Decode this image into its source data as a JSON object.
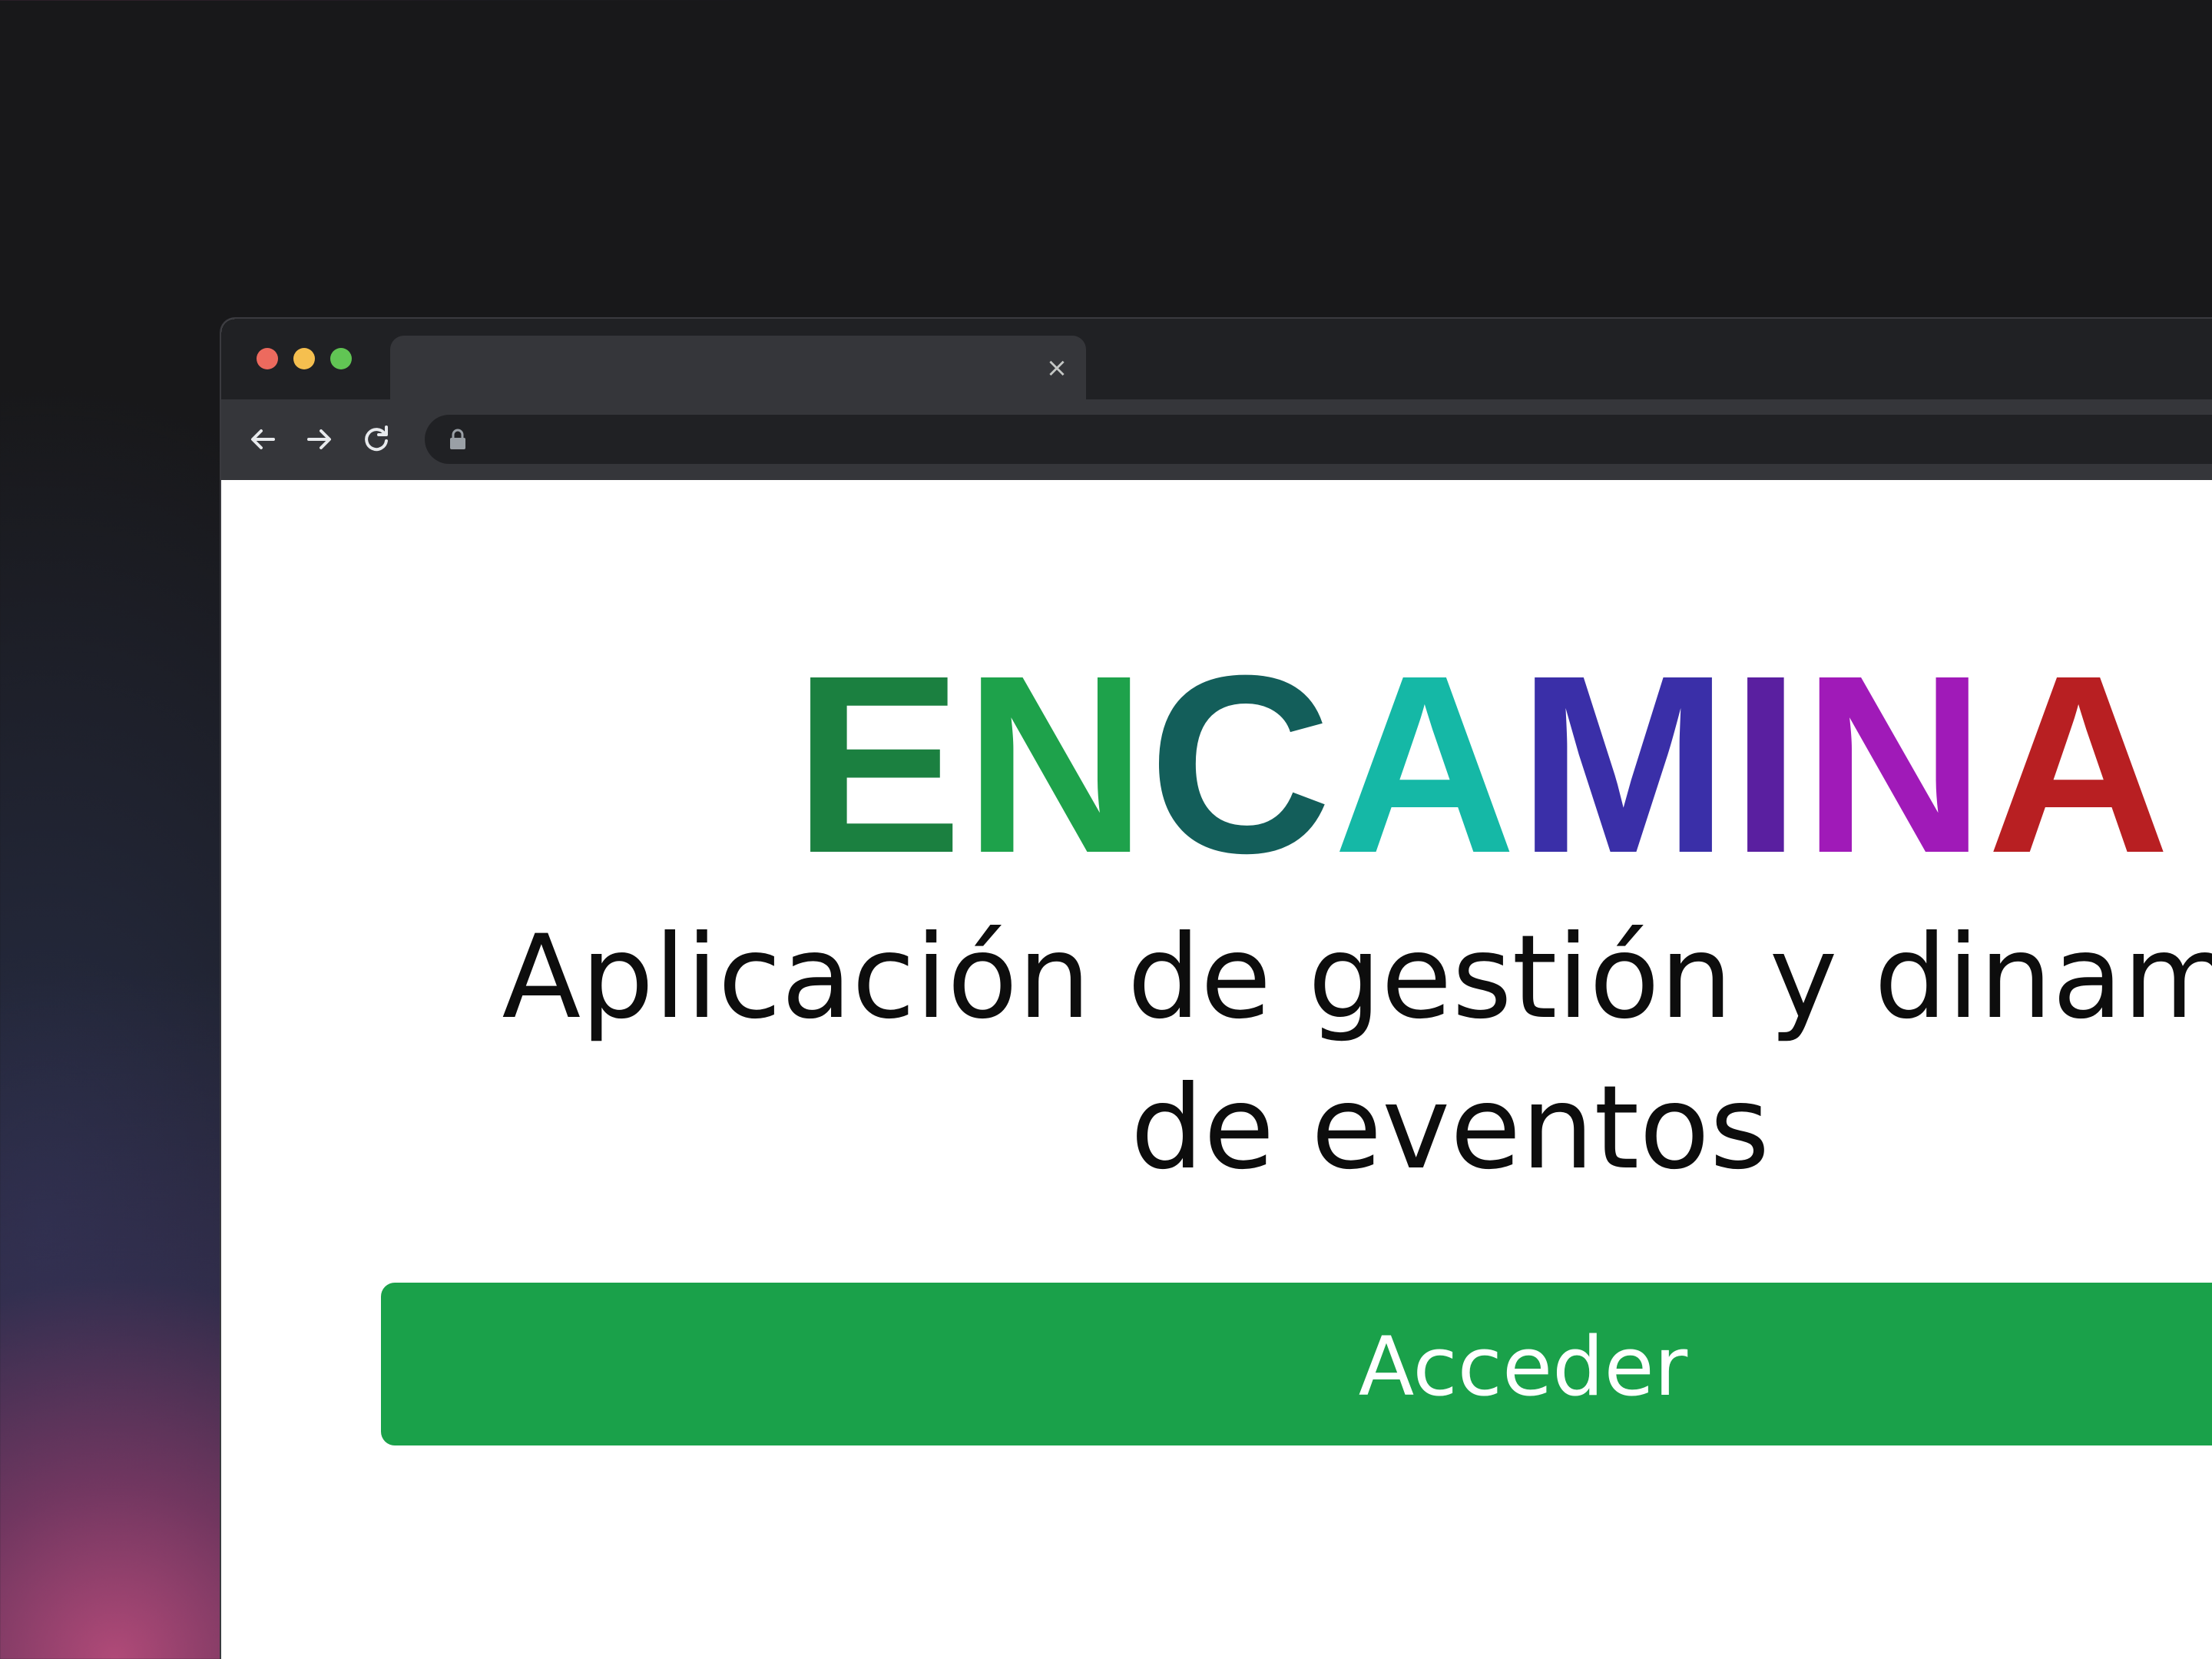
{
  "browser": {
    "tab": {
      "title": "",
      "close_glyph": "×"
    },
    "address_bar": {
      "url": "",
      "lock_icon": "lock-icon"
    },
    "nav": {
      "back_icon": "arrow-left-icon",
      "forward_icon": "arrow-right-icon",
      "reload_icon": "reload-icon"
    },
    "traffic_lights": {
      "close_color": "#ed6a5e",
      "minimize_color": "#f5bf4f",
      "maximize_color": "#61c554"
    }
  },
  "page": {
    "logo": {
      "letters": [
        {
          "char": "E",
          "color": "#1b8040"
        },
        {
          "char": "N",
          "color": "#1ea24b"
        },
        {
          "char": "C",
          "color": "#135e5a"
        },
        {
          "char": "A",
          "color": "#15b8a6"
        },
        {
          "char": "M",
          "color": "#3a2fa8"
        },
        {
          "char": "I",
          "color": "#5a1fa0"
        },
        {
          "char": "N",
          "color": "#a01ab8"
        },
        {
          "char": "A",
          "color": "#b81f22"
        }
      ]
    },
    "headline": {
      "line1": "Aplicación de gestión y dinamiza",
      "line2": "de eventos"
    },
    "cta": {
      "label": "Acceder",
      "color": "#1aa14a"
    }
  }
}
